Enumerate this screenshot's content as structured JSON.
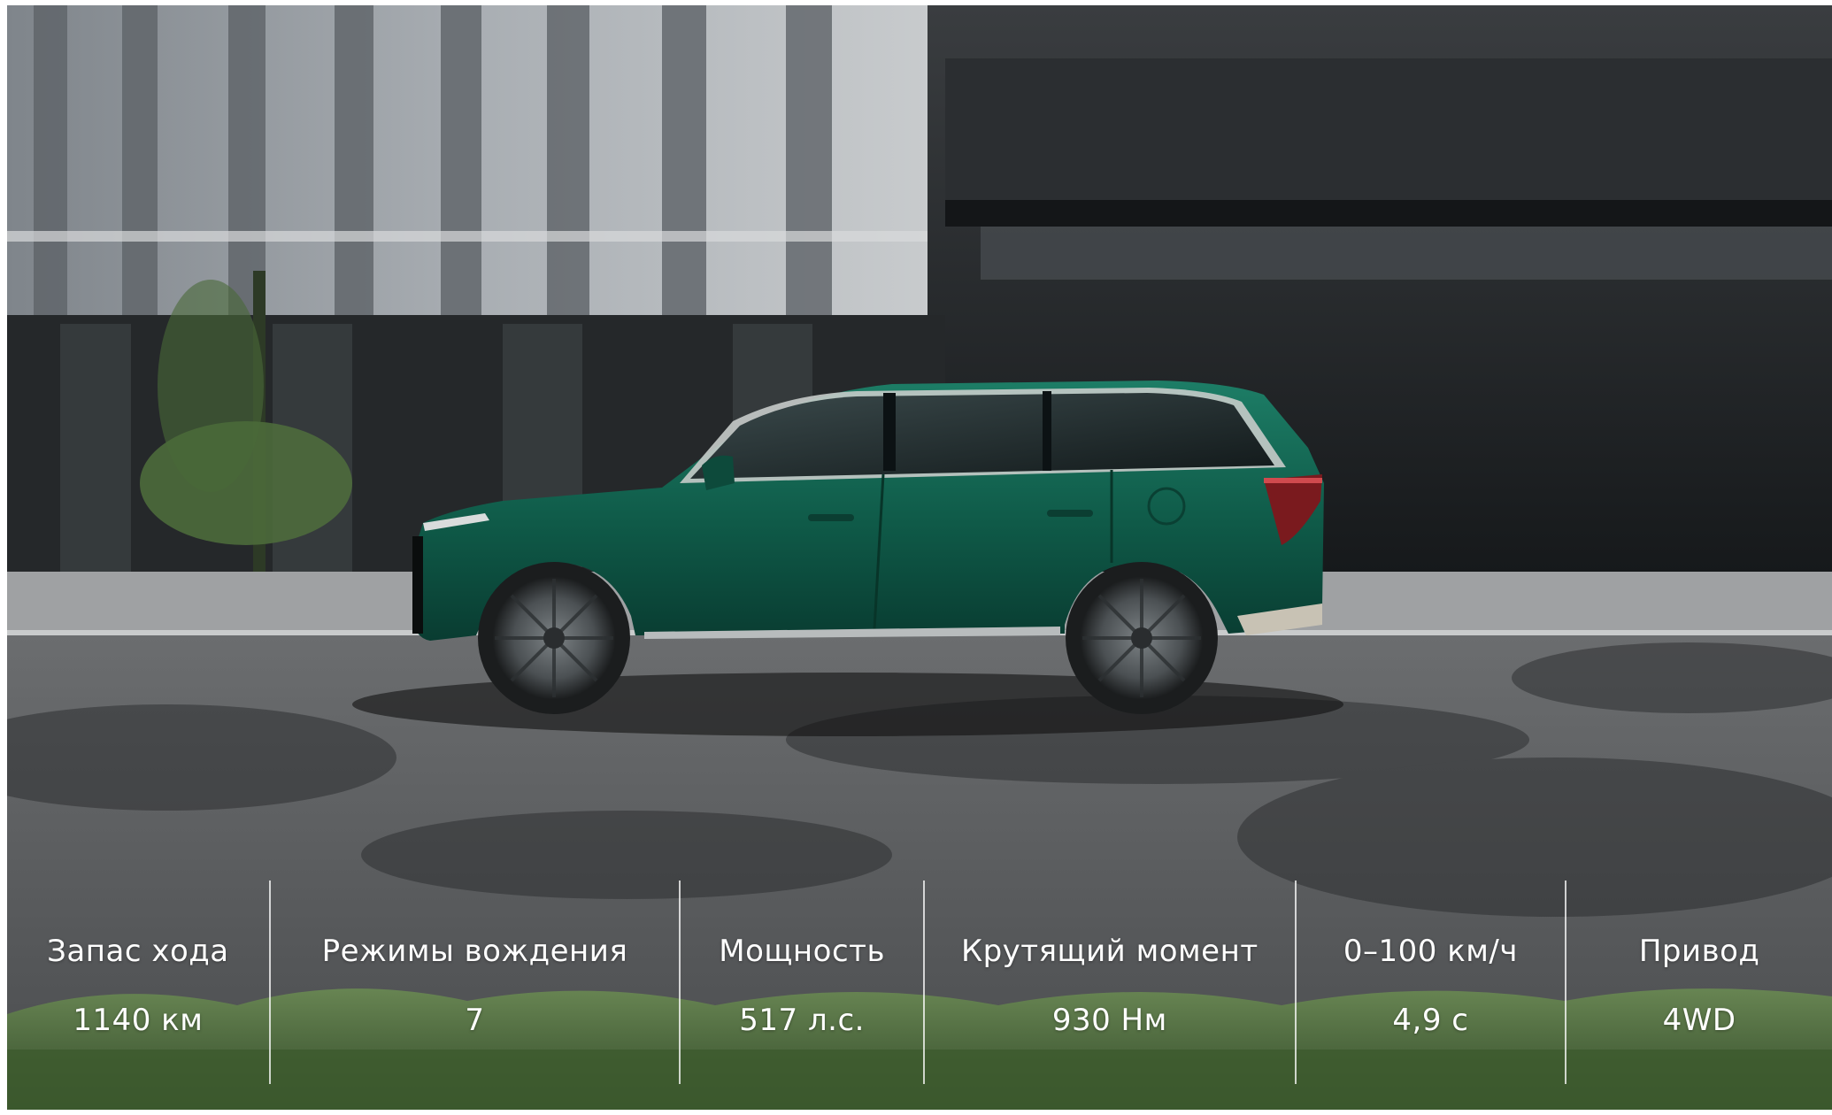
{
  "scene": {
    "description_icon": "car-photo",
    "colors": {
      "car_body": "#0f5a48",
      "car_body_light": "#1a7a62",
      "building_light": "#9ea3a8",
      "building_dark": "#1f2224",
      "road": "#5b5d5f",
      "greenery": "#4d6b3a"
    }
  },
  "specs": [
    {
      "label": "Запас хода",
      "value": "1140 км"
    },
    {
      "label": "Режимы вождения",
      "value": "7"
    },
    {
      "label": "Мощность",
      "value": "517 л.с."
    },
    {
      "label": "Крутящий момент",
      "value": "930 Нм"
    },
    {
      "label": "0–100 км/ч",
      "value": "4,9 с"
    },
    {
      "label": "Привод",
      "value": "4WD"
    }
  ]
}
